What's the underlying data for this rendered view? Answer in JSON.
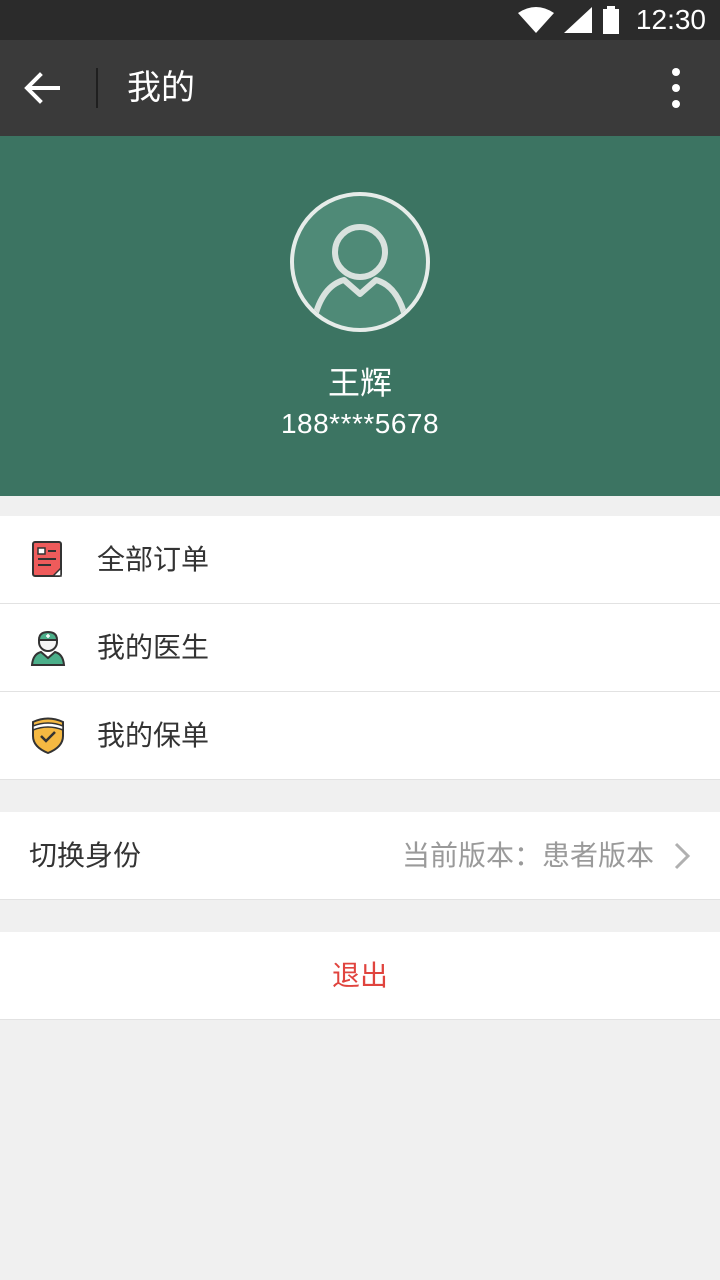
{
  "status_bar": {
    "time": "12:30",
    "icons": [
      "wifi-icon",
      "cell-signal-icon",
      "battery-icon"
    ]
  },
  "app_bar": {
    "title": "我的",
    "back_icon": "arrow-left-icon",
    "more_icon": "more-vert-icon"
  },
  "profile": {
    "name": "王辉",
    "phone": "188****5678",
    "avatar_icon": "user-avatar-icon",
    "background_color": "#3c7462"
  },
  "menu": {
    "items": [
      {
        "label": "全部订单",
        "icon": "order-list-icon",
        "icon_color": "#ef5b5b"
      },
      {
        "label": "我的医生",
        "icon": "doctor-icon",
        "icon_color": "#4caf8a"
      },
      {
        "label": "我的保单",
        "icon": "insurance-shield-icon",
        "icon_color": "#f5b942"
      }
    ]
  },
  "identity": {
    "label": "切换身份",
    "current_version": "当前版本：患者版本",
    "chevron_icon": "chevron-right-icon"
  },
  "logout": {
    "label": "退出",
    "color": "#e0443e"
  }
}
